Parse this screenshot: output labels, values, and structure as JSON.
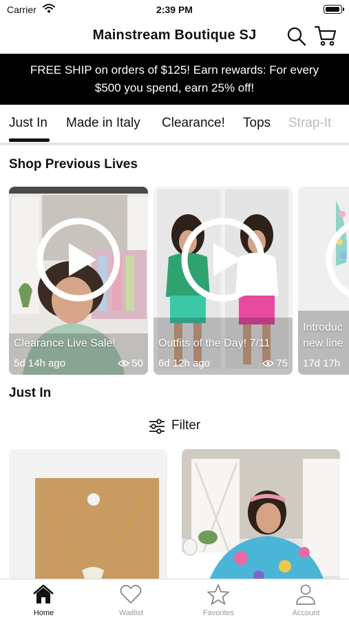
{
  "status_bar": {
    "carrier": "Carrier",
    "time": "2:39 PM",
    "battery_level": 1.0
  },
  "header": {
    "title": "Mainstream Boutique SJ",
    "search_icon": "search-icon",
    "cart_icon": "cart-icon"
  },
  "banner": {
    "line1": "FREE SHIP on orders of $125! Earn rewards: For every",
    "line2": "$500 you spend, earn 25% off!"
  },
  "category_tabs": [
    {
      "label": "Just In",
      "selected": true
    },
    {
      "label": "Made in Italy"
    },
    {
      "label": "Clearance!"
    },
    {
      "label": "Tops"
    },
    {
      "label": "Strap-It"
    }
  ],
  "previous_lives": {
    "title": "Shop Previous Lives",
    "items": [
      {
        "title": "Clearance Live Sale!",
        "ago": "5d 14h ago",
        "views": "50"
      },
      {
        "title": "Outfits of the Day! 7/11",
        "ago": "6d 12h ago",
        "views": "75"
      },
      {
        "title": "Introduc new line",
        "ago": "17d 17h"
      }
    ]
  },
  "just_in": {
    "title": "Just In",
    "filter_label": "Filter"
  },
  "tab_bar": [
    {
      "label": "Home",
      "icon": "home-icon",
      "active": true
    },
    {
      "label": "Waitlist",
      "icon": "heart-icon"
    },
    {
      "label": "Favorites",
      "icon": "star-icon"
    },
    {
      "label": "Account",
      "icon": "user-icon"
    }
  ],
  "colors": {
    "banner_bg": "#000000",
    "accent": "#111111",
    "inactive": "#999999"
  }
}
